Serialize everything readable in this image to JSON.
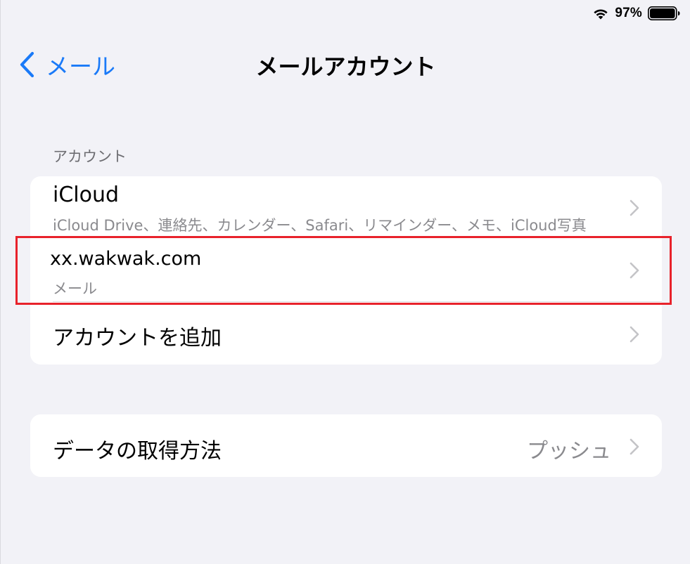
{
  "status_bar": {
    "battery_percent": "97%",
    "battery_level": 0.97,
    "wifi_icon": "wifi-icon",
    "battery_icon": "battery-icon"
  },
  "nav": {
    "back_label": "メール",
    "back_icon": "chevron-back-icon",
    "title": "メールアカウント"
  },
  "accounts_section": {
    "header": "アカウント",
    "rows": [
      {
        "title": "iCloud",
        "subtitle": "iCloud Drive、連絡先、カレンダー、Safari、リマインダー、メモ、iCloud写真"
      },
      {
        "title": "xx.wakwak.com",
        "subtitle": "メール"
      },
      {
        "title": "アカウントを追加"
      }
    ]
  },
  "fetch_section": {
    "title": "データの取得方法",
    "value": "プッシュ"
  },
  "colors": {
    "accent": "#1a7af8",
    "background": "#f2f2f7",
    "highlight": "#e8222b"
  }
}
